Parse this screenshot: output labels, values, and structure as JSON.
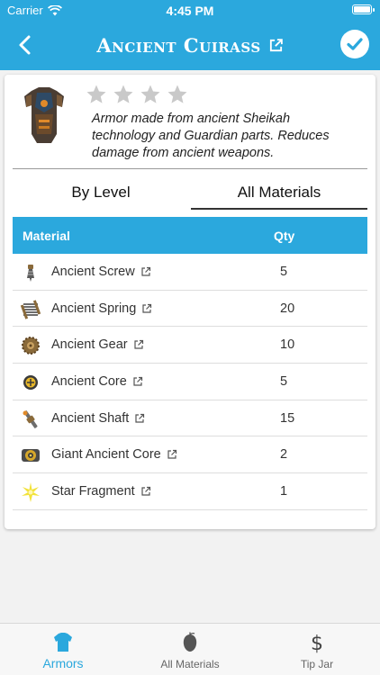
{
  "status": {
    "carrier": "Carrier",
    "time": "4:45 PM"
  },
  "nav": {
    "title": "Ancient Cuirass"
  },
  "item": {
    "description": "Armor made from ancient Sheikah technology and Guardian parts. Reduces damage from ancient weapons.",
    "rating": 0,
    "max_rating": 5
  },
  "tabs": {
    "by_level": "By Level",
    "all_materials": "All Materials"
  },
  "table": {
    "col_material": "Material",
    "col_qty": "Qty",
    "rows": [
      {
        "name": "Ancient Screw",
        "qty": "5",
        "icon": "screw-icon"
      },
      {
        "name": "Ancient Spring",
        "qty": "20",
        "icon": "spring-icon"
      },
      {
        "name": "Ancient Gear",
        "qty": "10",
        "icon": "gear-icon"
      },
      {
        "name": "Ancient Core",
        "qty": "5",
        "icon": "core-icon"
      },
      {
        "name": "Ancient Shaft",
        "qty": "15",
        "icon": "shaft-icon"
      },
      {
        "name": "Giant Ancient Core",
        "qty": "2",
        "icon": "giant-core-icon"
      },
      {
        "name": "Star Fragment",
        "qty": "1",
        "icon": "star-fragment-icon"
      }
    ]
  },
  "tabbar": {
    "armors": "Armors",
    "all_materials": "All Materials",
    "tip_jar": "Tip Jar"
  },
  "colors": {
    "accent": "#2ba8dd",
    "star_empty": "#c9c9c9"
  }
}
